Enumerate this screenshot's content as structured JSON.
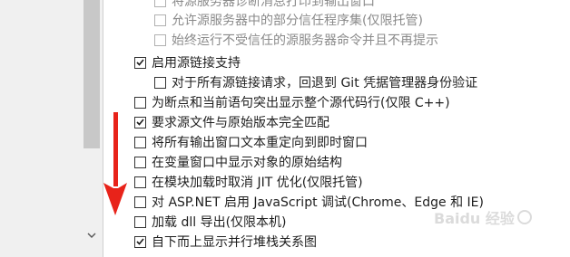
{
  "options": [
    {
      "label": "将源服务器诊断消息打印到输出窗口",
      "checked": false,
      "disabled": true
    },
    {
      "label": "允许源服务器中的部分信任程序集(仅限托管)",
      "checked": false,
      "disabled": true
    },
    {
      "label": "始终运行不受信任的源服务器命令并且不再提示",
      "checked": false,
      "disabled": true
    },
    {
      "label": "启用源链接支持",
      "checked": true,
      "disabled": false
    },
    {
      "label": "对于所有源链接请求，回退到 Git 凭据管理器身份验证",
      "checked": false,
      "disabled": false
    },
    {
      "label": "为断点和当前语句突出显示整个源代码行(仅限 C++)",
      "checked": false,
      "disabled": false
    },
    {
      "label": "要求源文件与原始版本完全匹配",
      "checked": true,
      "disabled": false
    },
    {
      "label": "将所有输出窗口文本重定向到即时窗口",
      "checked": false,
      "disabled": false
    },
    {
      "label": "在变量窗口中显示对象的原始结构",
      "checked": false,
      "disabled": false
    },
    {
      "label": "在模块加载时取消 JIT 优化(仅限托管)",
      "checked": false,
      "disabled": false
    },
    {
      "label": "对 ASP.NET 启用 JavaScript 调试(Chrome、Edge 和 IE)",
      "checked": false,
      "disabled": false
    },
    {
      "label": "加载 dll 导出(仅限本机)",
      "checked": false,
      "disabled": false
    },
    {
      "label": "自下而上显示并行堆栈关系图",
      "checked": true,
      "disabled": false
    }
  ],
  "scrollbar": {
    "down_icon": "chevron-down-icon"
  },
  "annotation": {
    "icon": "red-down-arrow-icon",
    "color": "#e8231a"
  },
  "watermark": {
    "text": "Baidu 经验"
  }
}
